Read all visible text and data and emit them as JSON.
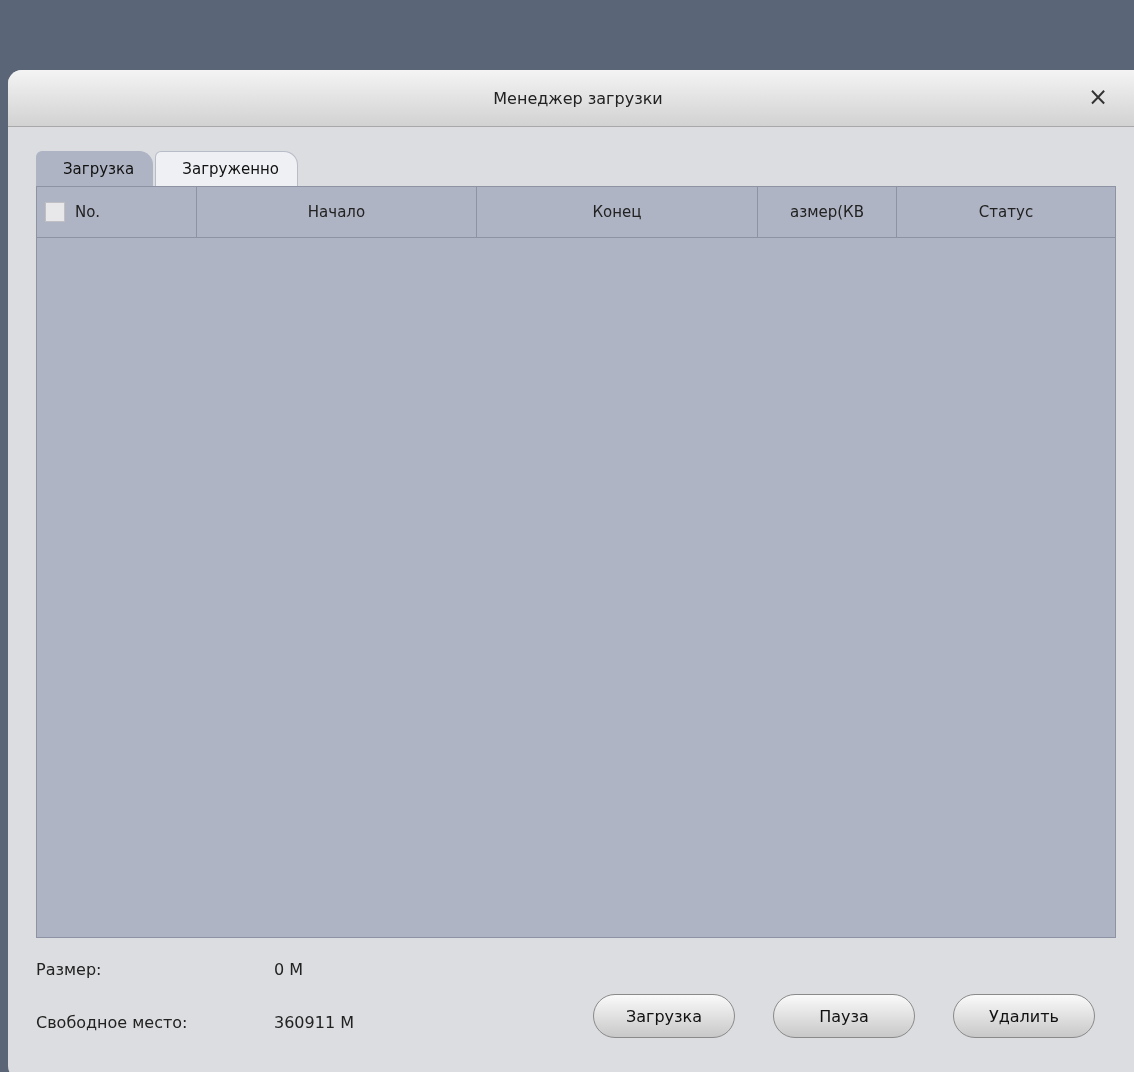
{
  "window": {
    "title": "Менеджер загрузки",
    "close": "×"
  },
  "tabs": [
    {
      "label": "Загрузка",
      "selected": true
    },
    {
      "label": "Загруженно",
      "selected": false
    }
  ],
  "table": {
    "select_all": {
      "checked": false
    },
    "columns": [
      "No.",
      "Начало",
      "Конец",
      "азмер(КВ",
      "Статус"
    ]
  },
  "summary": [
    {
      "label": "Размер:",
      "value": "0 М"
    },
    {
      "label": "Свободное место:",
      "value": "360911 М"
    }
  ],
  "buttons": [
    "Загрузка",
    "Пауза",
    "Удалить"
  ]
}
